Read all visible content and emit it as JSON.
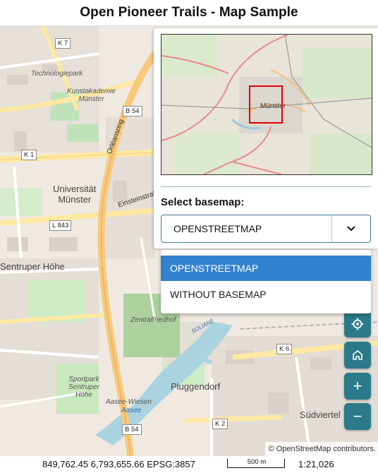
{
  "header": {
    "title": "Open Pioneer Trails - Map Sample"
  },
  "map": {
    "labels": {
      "technologiepark": "Technologiepark",
      "kunstakademie": "Kunstakademie\nMünster",
      "universitat": "Universität\nMünster",
      "einsteinstrasse": "Einsteinstraße",
      "orleansring": "Orléansring",
      "sentruper_hohe": "Sentruper Höhe",
      "zentralfriedhof": "Zentralfriedhof",
      "sportpark": "Sportpark\nSentruper\nHöhe",
      "aasee_wiesen": "Aasee-Wiesen",
      "aasee": "Aasee",
      "pluggendorf": "Pluggendorf",
      "sudviertel": "Südviertel",
      "soliane": "SOLIANE"
    },
    "roads": {
      "k7": "K 7",
      "b54_top": "B 54",
      "k1": "K 1",
      "l843": "L 843",
      "k6": "K 6",
      "k2": "K 2",
      "b54_bottom": "B 54"
    },
    "attribution": "© OpenStreetMap contributors."
  },
  "basemap_panel": {
    "overview_city": "Münster",
    "label": "Select basemap:",
    "selected_value": "OPENSTREETMAP",
    "options": [
      "OPENSTREETMAP",
      "WITHOUT BASEMAP"
    ]
  },
  "controls": {
    "locate_icon": "crosshair-icon",
    "home_icon": "home-icon",
    "zoom_in_label": "+",
    "zoom_out_label": "−",
    "accent": "#2b7a8a"
  },
  "footer": {
    "coordinates": "849,762.45 6,793,655.66 EPSG:3857",
    "scale_text": "500 m",
    "scale_ratio": "1:21,026"
  }
}
